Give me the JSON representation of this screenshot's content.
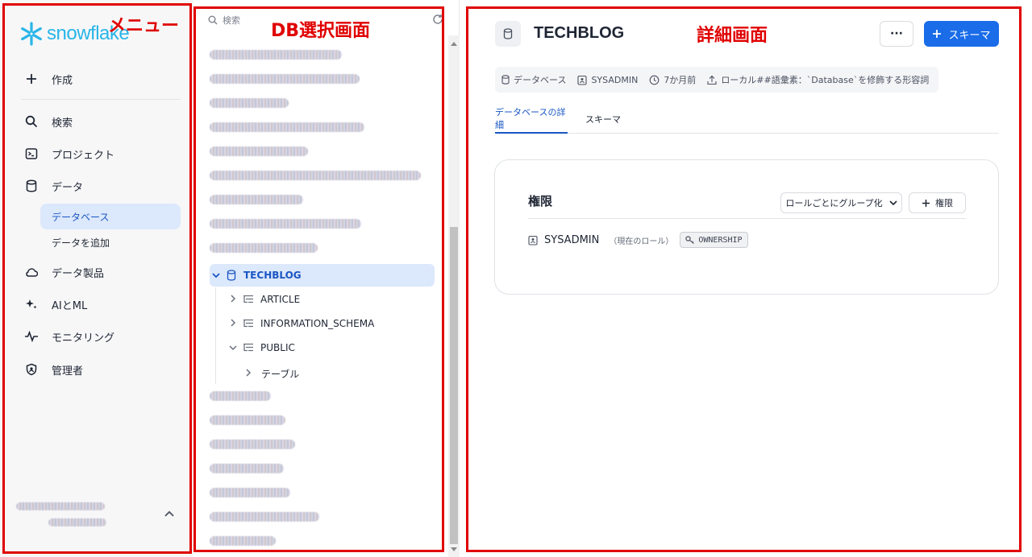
{
  "menu": {
    "logo_text": "snowflake",
    "create": "作成",
    "items": [
      {
        "label": "検索",
        "icon": "search-icon"
      },
      {
        "label": "プロジェクト",
        "icon": "terminal-icon"
      },
      {
        "label": "データ",
        "icon": "database-icon"
      },
      {
        "label": "データ製品",
        "icon": "cloud-icon"
      },
      {
        "label": "AIとML",
        "icon": "sparkle-icon"
      },
      {
        "label": "モニタリング",
        "icon": "activity-icon"
      },
      {
        "label": "管理者",
        "icon": "shield-icon"
      }
    ],
    "sub_items": [
      {
        "label": "データベース",
        "active": true
      },
      {
        "label": "データを追加",
        "active": false
      }
    ]
  },
  "tree": {
    "search_placeholder": "検索",
    "selected_db": "TECHBLOG",
    "schemas": [
      {
        "label": "ARTICLE",
        "expanded": false
      },
      {
        "label": "INFORMATION_SCHEMA",
        "expanded": false
      },
      {
        "label": "PUBLIC",
        "expanded": true
      }
    ],
    "public_children": [
      {
        "label": "テーブル"
      }
    ]
  },
  "detail": {
    "title": "TECHBLOG",
    "more_label": "···",
    "schema_button": "スキーマ",
    "meta": {
      "type": "データベース",
      "owner": "SYSADMIN",
      "created": "7か月前",
      "source": "ローカル##語彙素：`Database`を修飾する形容詞"
    },
    "tabs": [
      {
        "label": "データベースの詳細",
        "active": true
      },
      {
        "label": "スキーマ",
        "active": false
      }
    ],
    "permissions": {
      "title": "権限",
      "group_button": "ロールごとにグループ化",
      "add_button": "権限",
      "role": "SYSADMIN",
      "role_note": "（現在のロール）",
      "privilege": "OWNERSHIP"
    }
  },
  "annotations": {
    "menu": "メニュー",
    "db_select": "DB選択画面",
    "detail": "詳細画面",
    "color": "#e00000"
  },
  "colors": {
    "accent": "#1a6ce8",
    "selected_bg": "#dce8fb",
    "brand": "#29b5e8"
  }
}
